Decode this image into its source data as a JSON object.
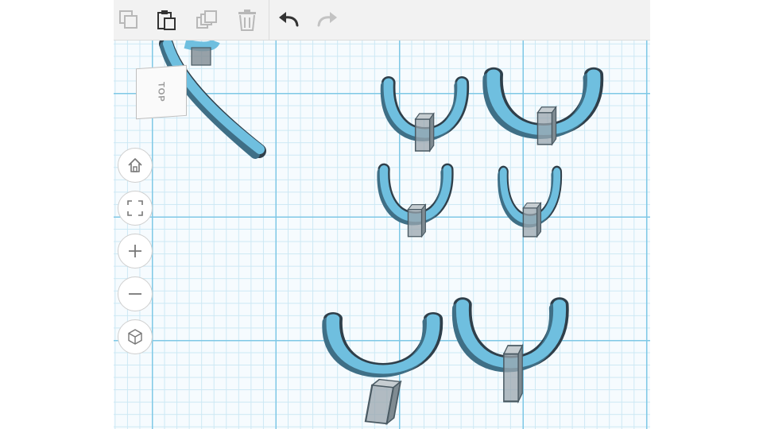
{
  "toolbar": {
    "buttons": [
      {
        "name": "copy-button",
        "icon": "copy-icon",
        "enabled": false
      },
      {
        "name": "paste-button",
        "icon": "paste-icon",
        "enabled": true
      },
      {
        "name": "duplicate-button",
        "icon": "duplicate-icon",
        "enabled": false
      },
      {
        "name": "delete-button",
        "icon": "trash-icon",
        "enabled": false
      },
      {
        "name": "undo-button",
        "icon": "undo-arrow-icon",
        "enabled": true
      },
      {
        "name": "redo-button",
        "icon": "redo-arrow-icon",
        "enabled": false
      }
    ]
  },
  "viewcube": {
    "label": "TOP"
  },
  "view_controls": [
    {
      "name": "home-view-button",
      "icon": "home-icon"
    },
    {
      "name": "fit-all-button",
      "icon": "fit-frame-icon"
    },
    {
      "name": "zoom-in-button",
      "icon": "plus-icon"
    },
    {
      "name": "zoom-out-button",
      "icon": "minus-icon"
    },
    {
      "name": "projection-button",
      "icon": "cube-icon"
    }
  ],
  "colors": {
    "shape_fill": "#6fbfdf",
    "shape_shadow": "#3f6f86",
    "shape_outline": "#2f3f4a",
    "hole_fill": "#9aa6ad",
    "grid_major": "#7fc8e6",
    "grid_minor": "#cce8f4",
    "toolbar_bg": "#f2f2f2",
    "icon_active": "#333333",
    "icon_disabled": "#b8b8b8"
  }
}
